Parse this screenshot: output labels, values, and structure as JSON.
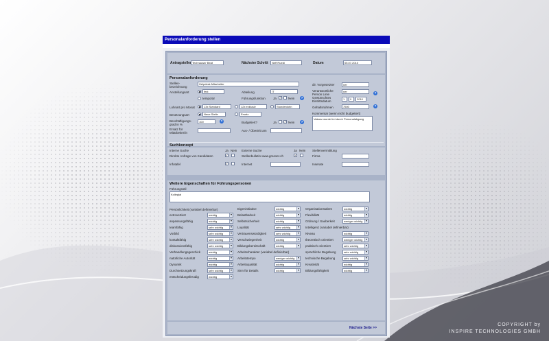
{
  "window": {
    "title": "Personalanforderung stellen"
  },
  "header": {
    "antragsteller_label": "Antragsteller",
    "antragsteller_value": "Technauser Beat",
    "naechster_schritt_label": "Nächster Schritt",
    "naechster_schritt_value": "Neff Ruedi",
    "datum_label": "Datum",
    "datum_value": "05.07.2010"
  },
  "personal": {
    "section_title": "Personalanforderung",
    "stellenbezeichnung_label": "Stellen-bezeichnung",
    "stellenbezeichnung_value": "Helpdesk Mitarbeiter",
    "vorgesetzter_label": "dir. Vorgesetzter",
    "vorgesetzter_value": "ner",
    "anstellungsart_label": "Anstellungsart",
    "fest_value": "fest",
    "temporaer_label": "temporär",
    "abteilung_label": "Abteilung",
    "abteilung_value": "IT",
    "verantwortliche_label": "Verantwortliche Person Linie",
    "verantwortliche_value": "ner",
    "fuehrungsfunktion_label": "Führungsfunktion",
    "ja": "Ja",
    "nein": "Nein",
    "eintrittsdatum_label": "Gewünschtes Eintrittsdatum",
    "eintritt_day": "1",
    "eintritt_month": "9",
    "eintritt_year": "2010",
    "lohnart_label": "Lohnart pro Monat",
    "lohnart_opt1": "13x Standard",
    "lohnart_opt2": "12x exklusiv",
    "lohnart_opt3": "Stundenlohn",
    "gehaltsrahmen_label": "Gehaltsrahmen",
    "gehaltsrahmen_value": "7500",
    "besetzungsart_label": "Besetzungsart",
    "besetzung_opt1": "Neue Stelle",
    "besetzung_opt2": "Ersatz",
    "kommentar_label": "Kommentar (wenn nicht budgetiert)",
    "kommentar_value": "Vakanz wurde frei durch Personalabgang",
    "beschaeftigungsgrad_label": "Beschäftigungs-grad in %",
    "beschaeftigungsgrad_value": "100",
    "budgetiert_label": "Budgetiert?",
    "ersatz_fuer_label": "Ersatz für Mitarbeiter/in",
    "aus_uebertritt_label": "Aus- / Übertritt am"
  },
  "suchkonzept": {
    "section_title": "Suchkonzept",
    "interne_suche": "Interne Suche",
    "ja": "Ja",
    "nein": "Nein",
    "direkte_anfrage": "Direkte Anfrage von Kandidaten",
    "infotafel": "Infotafel",
    "externe_suche": "Externe Suche",
    "stelleninserat": "Stellenbulletin www.greeser.ch",
    "internet": "Internet",
    "stellenvermittlung": "Stellenvermittlung",
    "firma": "Firma",
    "inserate": "Inserate"
  },
  "weitere": {
    "section_title": "Weitere Eigenschaften für Führungspersonen",
    "fuehrungsstil_label": "Führungsstil",
    "fuehrungsstil_value": "Kollegial",
    "col1_header": "Persönlichkeit (variabel definierbar)",
    "col2_header": "Eigeninitiative",
    "col3_header": "Organisationstalent",
    "col1": [
      {
        "label": "extrovertiert",
        "value": "wichtig"
      },
      {
        "label": "anpassungsfähig",
        "value": "wichtig"
      },
      {
        "label": "teamfähig",
        "value": "sehr wichtig"
      },
      {
        "label": "Vorbild",
        "value": "sehr wichtig"
      },
      {
        "label": "kontaktfähig",
        "value": "sehr wichtig"
      },
      {
        "label": "diskussionsfähig",
        "value": "sehr wichtig"
      },
      {
        "label": "Verhandlungsgeschick",
        "value": "wichtig"
      },
      {
        "label": "natürliche Autorität",
        "value": "wichtig"
      },
      {
        "label": "Dynamik",
        "value": "wichtig"
      },
      {
        "label": "Durchsetzungskraft",
        "value": "sehr wichtig"
      },
      {
        "label": "entscheidungsfreudig",
        "value": "wichtig"
      }
    ],
    "col2": [
      {
        "label": "Eigeninitiative",
        "value": "wichtig"
      },
      {
        "label": "Belastbarkeit",
        "value": "wichtig"
      },
      {
        "label": "Selbstsicherheit",
        "value": "wichtig"
      },
      {
        "label": "Loyalität",
        "value": "sehr wichtig"
      },
      {
        "label": "Vertrauenswürdigkeit",
        "value": "sehr wichtig"
      },
      {
        "label": "Verschwiegenheit",
        "value": "wichtig"
      },
      {
        "label": "Bildungsbereitschaft",
        "value": "wichtig"
      },
      {
        "label": "Arbeitscharakter (variabel definierbar)",
        "value": ""
      },
      {
        "label": "Arbeitstempo",
        "value": "weniger wichtig"
      },
      {
        "label": "Arbeitsqualität",
        "value": "wichtig"
      },
      {
        "label": "Sinn für Details",
        "value": "wichtig"
      }
    ],
    "col3": [
      {
        "label": "Organisationstalent",
        "value": "wichtig"
      },
      {
        "label": "Flexibilität",
        "value": "wichtig"
      },
      {
        "label": "Ordnung / Sauberkeit",
        "value": "weniger wichtig"
      },
      {
        "label": "Intelligenz (variabel definierbar)",
        "value": ""
      },
      {
        "label": "Niveau",
        "value": "wichtig"
      },
      {
        "label": "theoretisch orientiert",
        "value": "weniger wichtig"
      },
      {
        "label": "praktisch orientiert",
        "value": "sehr wichtig"
      },
      {
        "label": "sprachliche Begabung",
        "value": "sehr wichtig"
      },
      {
        "label": "technische Begabung",
        "value": "sehr wichtig"
      },
      {
        "label": "Kreativität",
        "value": "wichtig"
      },
      {
        "label": "Bildungsfähigkeit",
        "value": "wichtig"
      }
    ]
  },
  "footer": {
    "next_label": "Nächste Seite >>"
  },
  "copyright": {
    "line1": "COPYRIGHT by",
    "line2": "INSPIRE TECHNOLOGIES GMBH"
  }
}
